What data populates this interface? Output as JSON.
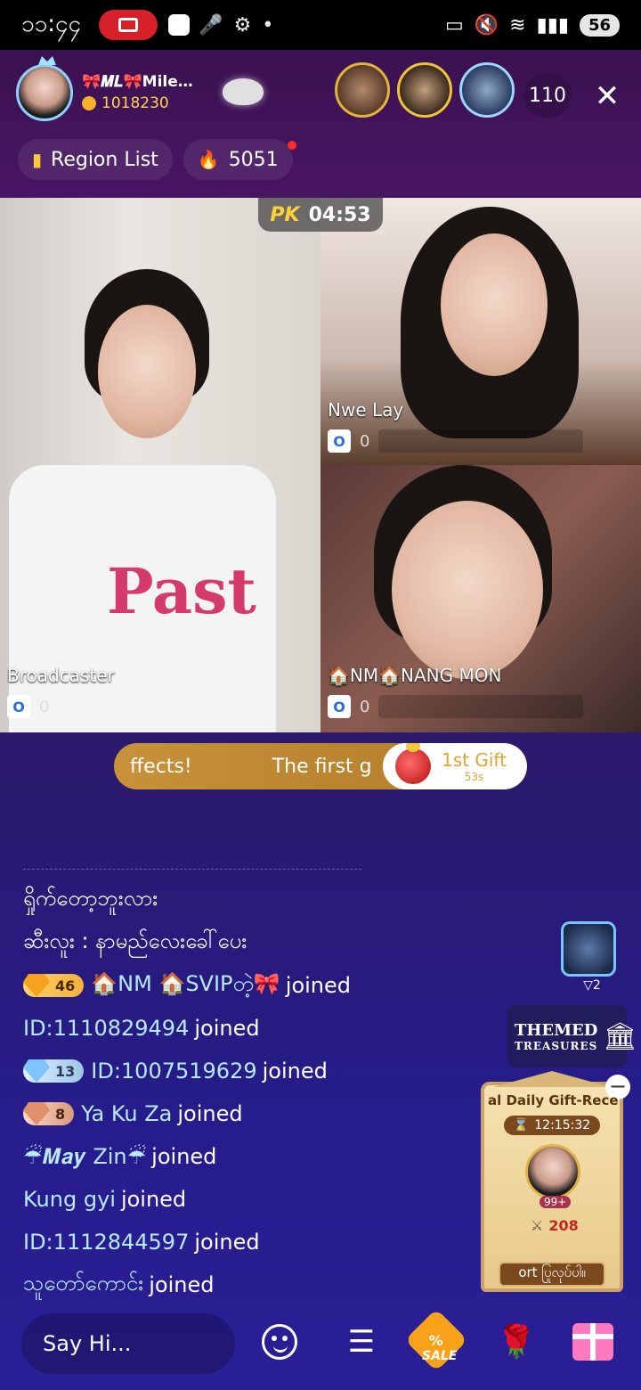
{
  "status_bar": {
    "time": "၁၁:၄၄",
    "battery": "56"
  },
  "header": {
    "host_name": "🎀𝑴𝑳🎀Mile…",
    "host_coins": "1018230",
    "viewer_count": "110",
    "close_label": "✕"
  },
  "sub_header": {
    "region_list_label": "Region List",
    "popularity": "5051"
  },
  "pk": {
    "logo": "PK",
    "timer": "04:53"
  },
  "cams": [
    {
      "label": "Broadcaster",
      "score": "0"
    },
    {
      "label": "Nwe Lay",
      "score": "0"
    },
    {
      "label": "🏠NM🏠NANG MON",
      "score": "0"
    }
  ],
  "marquee": {
    "text_left": "ffects!",
    "text_right": "The first g",
    "gift_title": "1st Gift",
    "gift_countdown": "53s"
  },
  "chat": {
    "messages": [
      {
        "text": "ရှိုက်တော့ဘူးလား"
      },
      {
        "text": "ဆီးလူး : နာမည်လေးခေါ်ပေး"
      },
      {
        "level": "46",
        "name": "🏠NM 🏠SVIPတဲ့🎀",
        "action": "joined"
      },
      {
        "name": "ID:1110829494",
        "action": "joined"
      },
      {
        "level": "13",
        "name": "ID:1007519629",
        "action": "joined"
      },
      {
        "level": "8",
        "name": "Ya Ku Za",
        "action": "joined"
      },
      {
        "name": "☔𝑴𝒂𝒚 Zin☔",
        "action": "joined"
      },
      {
        "name": "Kung gyi",
        "action": "joined"
      },
      {
        "name": "ID:1112844597",
        "action": "joined"
      },
      {
        "name": "သူတော်ကောင်း",
        "action": "joined"
      }
    ]
  },
  "side_widgets": {
    "rank_count": "▽2",
    "themed_line1": "THEMED",
    "themed_line2": "TREASURES",
    "daily_gift_title": "al Daily Gift-Recei",
    "daily_gift_timer": "12:15:32",
    "daily_gift_badge": "99+",
    "daily_gift_score": "208",
    "daily_gift_footer": "ort ပြုလုပ်ပါ။"
  },
  "bottom_bar": {
    "input_placeholder": "Say Hi...",
    "sale_label": "SALE"
  }
}
